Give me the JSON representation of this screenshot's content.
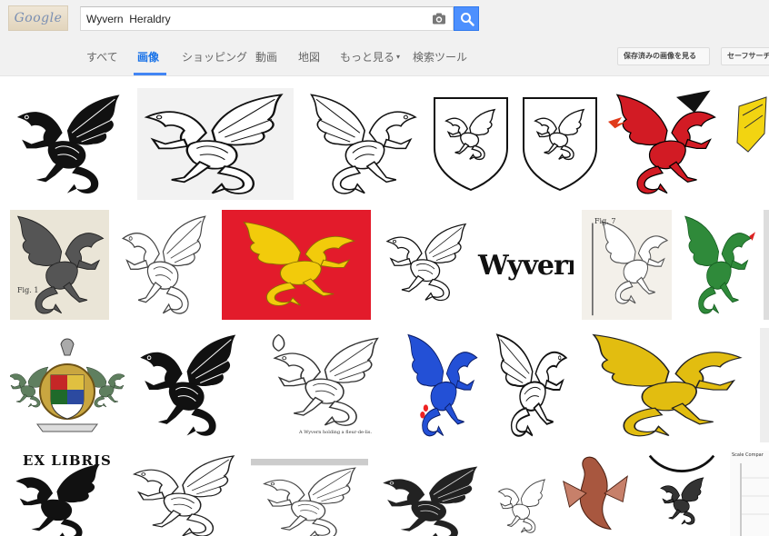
{
  "header": {
    "logo_text": "Google",
    "search_value": "Wyvern  Heraldry"
  },
  "nav": {
    "tabs": [
      {
        "label": "すべて"
      },
      {
        "label": "画像"
      },
      {
        "label": "ショッピング"
      },
      {
        "label": "動画"
      },
      {
        "label": "地図"
      },
      {
        "label": "もっと見る"
      },
      {
        "label": "検索ツール"
      }
    ],
    "saved_images_label": "保存済みの画像を見る",
    "safesearch_label": "セーフサーチ"
  },
  "results": {
    "labels": {
      "fig1": "Fig. 1",
      "fig7": "Fig. 7",
      "wyvern_word": "Wyvern",
      "caption_row3": "A Wyvern holding a fleur-de-lis.",
      "ex_libris": "EX LIBRIS",
      "scale_title": "Scale Compar"
    }
  },
  "colors": {
    "accent": "#4285f4",
    "search_button": "#4d90fe",
    "red_field": "#e31b2b",
    "gold": "#e2bd10",
    "green": "#2f8a3a",
    "blue": "#2350d6"
  }
}
